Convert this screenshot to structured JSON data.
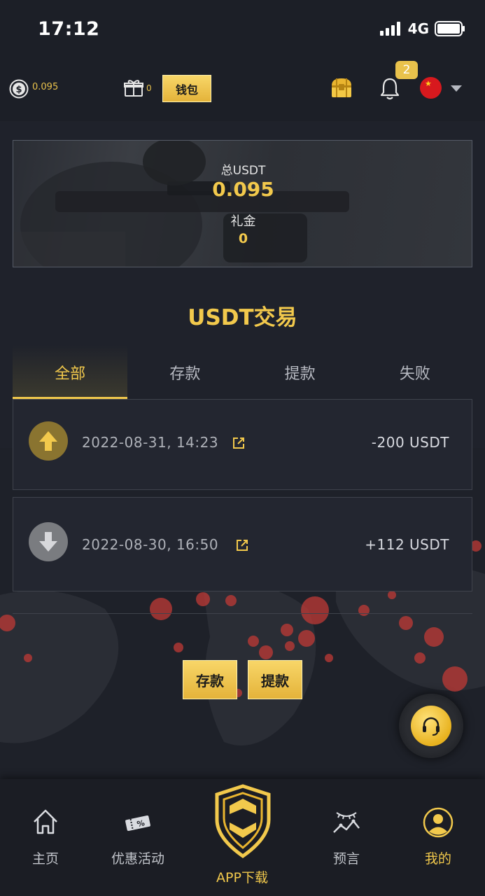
{
  "status_bar": {
    "time": "17:12",
    "network": "4G"
  },
  "header": {
    "balance": "0.095",
    "gift_count": "0",
    "wallet_label": "钱包",
    "notification_count": "2",
    "language_flag": "china-flag-icon"
  },
  "balance_card": {
    "total_label": "总USDT",
    "total_value": "0.095",
    "bonus_label": "礼金",
    "bonus_value": "0"
  },
  "section_title": "USDT交易",
  "tabs": [
    {
      "label": "全部",
      "active": true
    },
    {
      "label": "存款",
      "active": false
    },
    {
      "label": "提款",
      "active": false
    },
    {
      "label": "失败",
      "active": false
    }
  ],
  "transactions": [
    {
      "direction": "up",
      "datetime": "2022-08-31, 14:23",
      "amount": "-200 USDT"
    },
    {
      "direction": "down",
      "datetime": "2022-08-30, 16:50",
      "amount": "+112 USDT"
    }
  ],
  "actions": {
    "deposit_label": "存款",
    "withdraw_label": "提款"
  },
  "bottom_nav": {
    "home": "主页",
    "promotions": "优惠活动",
    "app_download": "APP下载",
    "prediction": "预言",
    "mine": "我的"
  },
  "colors": {
    "accent": "#f2c94c",
    "background": "#1f222b",
    "header": "#1c1f27"
  }
}
